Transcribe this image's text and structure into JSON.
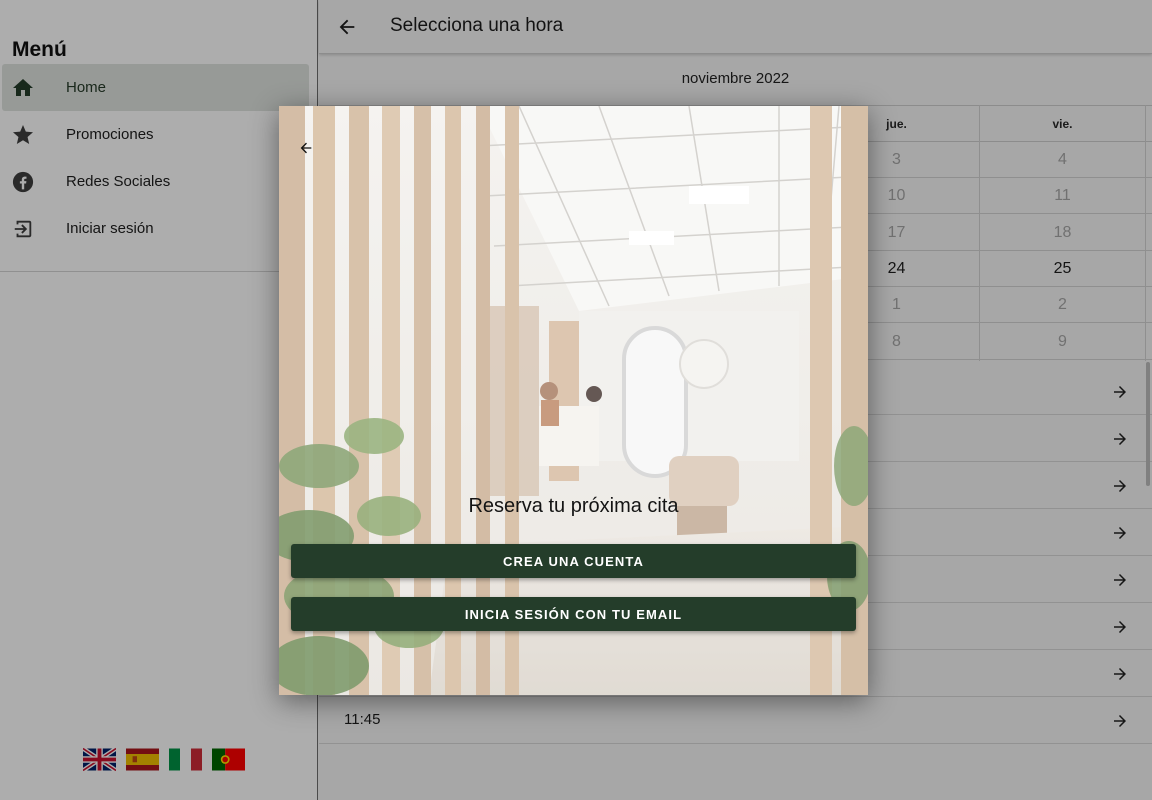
{
  "drawer": {
    "title": "Menú",
    "items": [
      {
        "label": "Home",
        "icon": "home-icon",
        "active": true
      },
      {
        "label": "Promociones",
        "icon": "star-icon",
        "active": false
      },
      {
        "label": "Redes Sociales",
        "icon": "facebook-icon",
        "active": false
      },
      {
        "label": "Iniciar sesión",
        "icon": "login-icon",
        "active": false
      }
    ],
    "languages": [
      "flag-uk-icon",
      "flag-spain-icon",
      "flag-italy-icon",
      "flag-portugal-icon"
    ]
  },
  "appbar": {
    "title": "Selecciona una hora",
    "back_icon": "arrow-back-icon"
  },
  "calendar": {
    "month": "noviembre 2022",
    "headers": [
      "jue.",
      "vie."
    ],
    "rows": [
      [
        "3",
        "4"
      ],
      [
        "10",
        "11"
      ],
      [
        "17",
        "18"
      ],
      [
        "24",
        "25"
      ],
      [
        "1",
        "2"
      ],
      [
        "8",
        "9"
      ]
    ],
    "active_row": 3
  },
  "slots": {
    "last_visible_time": "11:45",
    "arrow_icon": "arrow-forward-icon"
  },
  "dialog": {
    "title": "Reserva tu próxima cita",
    "create_account": "CREA UNA CUENTA",
    "email_login": "INICIA SESIÓN CON TU EMAIL",
    "back_icon": "arrow-back-icon",
    "button_color": "#243d2a"
  },
  "colors": {
    "accent": "#243d2a",
    "scrim": "rgba(0,0,0,0.32)"
  }
}
